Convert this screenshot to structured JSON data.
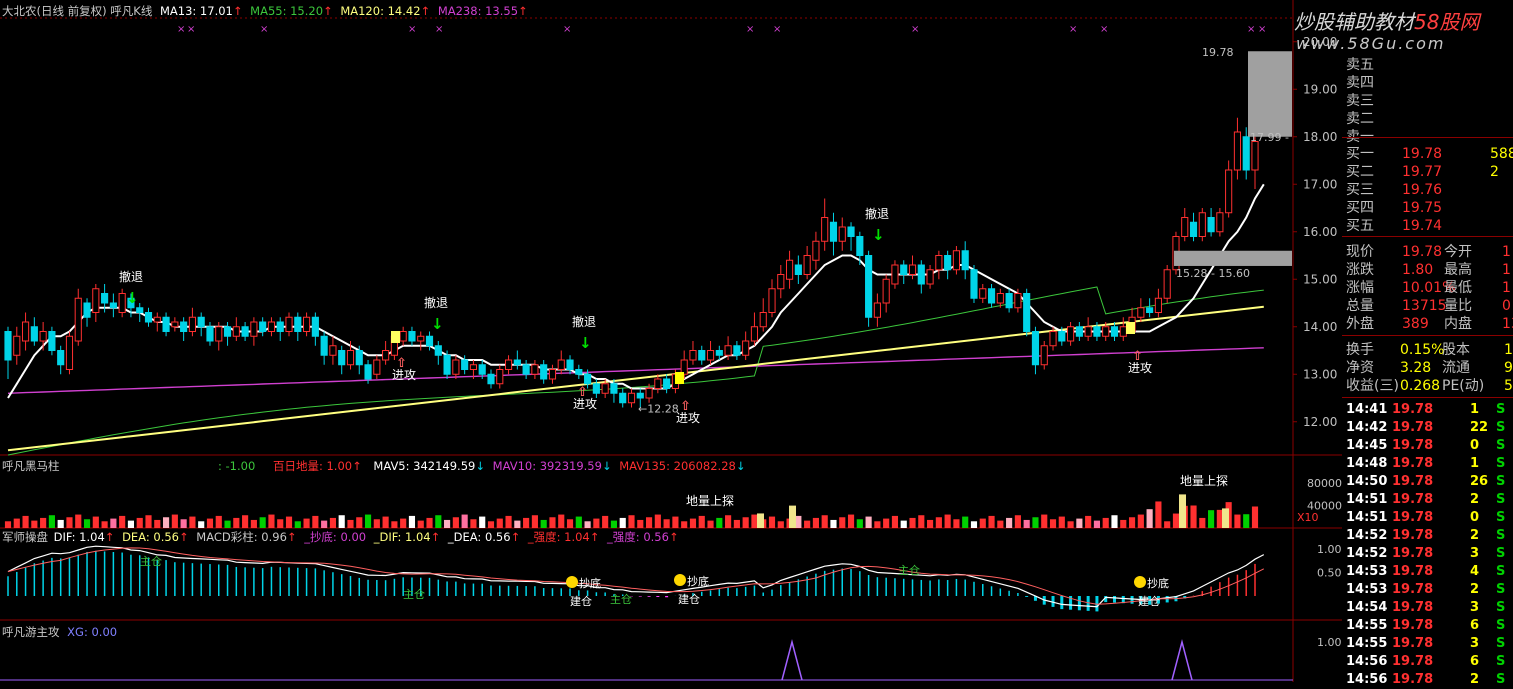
{
  "colors": {
    "bg": "#000000",
    "grid": "#8b0000",
    "up": "#ff3030",
    "down": "#00d4e8",
    "ma13": "#ffffff",
    "ma55": "#3cc63c",
    "ma120": "#ffff80",
    "ma238": "#d040d0",
    "label": "#ffffff",
    "green_arrow": "#00e000"
  },
  "main_header": {
    "title": "大北农(日线 前复权) 呼凡K线",
    "ma13": "MA13: 17.01",
    "ma55": "MA55: 15.20",
    "ma120": "MA120: 14.42",
    "ma238": "MA238: 13.55"
  },
  "vol_header": {
    "title": "呼凡黑马柱",
    "neg": ": -1.00",
    "baiday": "百日地量: 1.00",
    "mav5": "MAV5: 342149.59",
    "mav10": "MAV10: 392319.59",
    "mav135": "MAV135: 206082.28"
  },
  "macd_header": {
    "title": "军师操盘",
    "dif": "DIF: 1.04",
    "dea": "DEA: 0.56",
    "macd": "MACD彩柱: 0.96",
    "chaodi": "_抄底: 0.00",
    "dif2": "_DIF: 1.04",
    "dea2": "_DEA: 0.56",
    "qiang1": "_强度: 1.04",
    "qiang2": "_强度: 0.56"
  },
  "xg_header": {
    "title": "呼凡游主攻",
    "xg": "XG: 0.00"
  },
  "watermark": {
    "line1": "炒股辅助教材",
    "brand": "58股网",
    "url": "www.58Gu.com"
  },
  "annotations": {
    "retreat": "撤退",
    "attack": "进攻",
    "probe": "地量上探",
    "chaodi": "抄底",
    "jincang": "建仓",
    "zhucang": "主仓"
  },
  "chart_data": {
    "type": "candlestick",
    "price_axis": {
      "ylim": [
        11.3,
        20.5
      ],
      "ticks": [
        "12.00",
        "13.00",
        "14.00",
        "15.00",
        "16.00",
        "17.00",
        "18.00",
        "19.00",
        "20.00"
      ]
    },
    "volume_axis": {
      "ticks": [
        "80000",
        "40000"
      ],
      "unit": "X10"
    },
    "macd_axis": {
      "ticks": [
        "1.00",
        "0.50"
      ]
    },
    "xg_axis": {
      "ticks": [
        "1.00"
      ]
    },
    "price_labels": [
      "19.78",
      "17.99",
      "15.28 - 15.60",
      "12.28"
    ],
    "candles": [
      [
        13.9,
        13.3,
        14.0,
        12.9
      ],
      [
        13.4,
        13.8,
        14.0,
        13.2
      ],
      [
        13.7,
        14.1,
        14.3,
        13.5
      ],
      [
        14.0,
        13.7,
        14.2,
        13.6
      ],
      [
        13.7,
        13.9,
        14.1,
        13.5
      ],
      [
        13.9,
        13.5,
        14.0,
        13.4
      ],
      [
        13.5,
        13.2,
        13.6,
        13.0
      ],
      [
        13.1,
        13.8,
        13.9,
        13.0
      ],
      [
        13.7,
        14.6,
        14.8,
        13.6
      ],
      [
        14.5,
        14.2,
        14.6,
        14.0
      ],
      [
        14.3,
        14.8,
        14.9,
        14.1
      ],
      [
        14.7,
        14.5,
        14.9,
        14.3
      ],
      [
        14.5,
        14.4,
        14.7,
        14.2
      ],
      [
        14.3,
        14.7,
        14.8,
        14.2
      ],
      [
        14.6,
        14.4,
        14.7,
        14.2
      ],
      [
        14.4,
        14.3,
        14.5,
        14.1
      ],
      [
        14.3,
        14.1,
        14.4,
        14.0
      ],
      [
        14.1,
        14.2,
        14.3,
        13.9
      ],
      [
        14.2,
        13.9,
        14.3,
        13.8
      ],
      [
        14.0,
        14.1,
        14.2,
        13.9
      ],
      [
        14.1,
        13.9,
        14.2,
        13.7
      ],
      [
        13.9,
        14.2,
        14.4,
        13.8
      ],
      [
        14.2,
        14.0,
        14.3,
        13.8
      ],
      [
        14.0,
        13.7,
        14.1,
        13.6
      ],
      [
        13.7,
        14.0,
        14.1,
        13.5
      ],
      [
        14.0,
        13.8,
        14.1,
        13.6
      ],
      [
        13.8,
        14.0,
        14.2,
        13.7
      ],
      [
        14.0,
        13.8,
        14.1,
        13.7
      ],
      [
        13.8,
        14.1,
        14.2,
        13.6
      ],
      [
        14.1,
        13.9,
        14.2,
        13.8
      ],
      [
        13.9,
        14.1,
        14.2,
        13.8
      ],
      [
        14.1,
        13.9,
        14.2,
        13.7
      ],
      [
        13.9,
        14.2,
        14.3,
        13.8
      ],
      [
        14.2,
        13.9,
        14.3,
        13.7
      ],
      [
        13.9,
        14.2,
        14.3,
        13.8
      ],
      [
        14.2,
        13.8,
        14.3,
        13.6
      ],
      [
        13.8,
        13.4,
        13.9,
        13.2
      ],
      [
        13.4,
        13.6,
        13.8,
        13.2
      ],
      [
        13.5,
        13.2,
        13.6,
        13.0
      ],
      [
        13.2,
        13.5,
        13.7,
        13.1
      ],
      [
        13.5,
        13.2,
        13.6,
        13.0
      ],
      [
        13.2,
        12.9,
        13.3,
        12.8
      ],
      [
        13.0,
        13.3,
        13.4,
        12.9
      ],
      [
        13.3,
        13.5,
        13.7,
        13.2
      ],
      [
        13.4,
        13.8,
        13.9,
        13.3
      ],
      [
        13.7,
        13.9,
        14.0,
        13.6
      ],
      [
        13.9,
        13.7,
        14.0,
        13.6
      ],
      [
        13.7,
        13.8,
        13.9,
        13.5
      ],
      [
        13.8,
        13.6,
        13.9,
        13.5
      ],
      [
        13.6,
        13.4,
        13.7,
        13.2
      ],
      [
        13.4,
        13.0,
        13.5,
        12.9
      ],
      [
        13.0,
        13.3,
        13.4,
        12.9
      ],
      [
        13.3,
        13.1,
        13.4,
        13.0
      ],
      [
        13.1,
        13.2,
        13.3,
        12.9
      ],
      [
        13.2,
        13.0,
        13.3,
        12.9
      ],
      [
        13.0,
        12.8,
        13.1,
        12.7
      ],
      [
        12.8,
        13.1,
        13.2,
        12.7
      ],
      [
        13.1,
        13.3,
        13.4,
        13.0
      ],
      [
        13.3,
        13.2,
        13.5,
        13.1
      ],
      [
        13.2,
        13.0,
        13.3,
        12.9
      ],
      [
        13.0,
        13.2,
        13.3,
        12.9
      ],
      [
        13.2,
        12.9,
        13.3,
        12.8
      ],
      [
        12.9,
        13.1,
        13.2,
        12.8
      ],
      [
        13.1,
        13.3,
        13.5,
        13.0
      ],
      [
        13.3,
        13.1,
        13.4,
        13.0
      ],
      [
        13.1,
        13.0,
        13.2,
        12.9
      ],
      [
        13.0,
        12.8,
        13.1,
        12.7
      ],
      [
        12.8,
        12.6,
        12.9,
        12.5
      ],
      [
        12.6,
        12.8,
        12.9,
        12.5
      ],
      [
        12.8,
        12.6,
        12.9,
        12.4
      ],
      [
        12.6,
        12.4,
        12.7,
        12.3
      ],
      [
        12.4,
        12.6,
        12.7,
        12.3
      ],
      [
        12.6,
        12.5,
        12.7,
        12.3
      ],
      [
        12.5,
        12.7,
        12.8,
        12.4
      ],
      [
        12.7,
        12.9,
        13.0,
        12.6
      ],
      [
        12.9,
        12.7,
        13.0,
        12.6
      ],
      [
        12.7,
        13.0,
        13.1,
        12.6
      ],
      [
        13.0,
        13.3,
        13.5,
        12.9
      ],
      [
        13.3,
        13.5,
        13.7,
        13.2
      ],
      [
        13.5,
        13.3,
        13.6,
        13.2
      ],
      [
        13.3,
        13.5,
        13.7,
        13.2
      ],
      [
        13.5,
        13.4,
        13.6,
        13.3
      ],
      [
        13.4,
        13.6,
        13.8,
        13.3
      ],
      [
        13.6,
        13.4,
        13.7,
        13.3
      ],
      [
        13.4,
        13.7,
        13.9,
        13.3
      ],
      [
        13.7,
        14.0,
        14.3,
        13.6
      ],
      [
        14.0,
        14.3,
        14.6,
        13.9
      ],
      [
        14.3,
        14.8,
        15.0,
        14.2
      ],
      [
        14.8,
        15.1,
        15.3,
        14.6
      ],
      [
        15.0,
        15.4,
        15.6,
        14.8
      ],
      [
        15.3,
        15.1,
        15.5,
        14.9
      ],
      [
        15.1,
        15.5,
        15.7,
        15.0
      ],
      [
        15.4,
        15.8,
        16.0,
        15.2
      ],
      [
        15.8,
        16.3,
        16.7,
        15.6
      ],
      [
        16.2,
        15.8,
        16.4,
        15.5
      ],
      [
        15.8,
        16.1,
        16.3,
        15.6
      ],
      [
        16.1,
        15.9,
        16.2,
        15.6
      ],
      [
        15.9,
        15.5,
        16.0,
        15.3
      ],
      [
        15.5,
        14.2,
        15.6,
        14.0
      ],
      [
        14.2,
        14.5,
        14.7,
        14.0
      ],
      [
        14.5,
        15.0,
        15.1,
        14.3
      ],
      [
        14.9,
        15.3,
        15.4,
        14.8
      ],
      [
        15.3,
        15.1,
        15.4,
        14.9
      ],
      [
        15.1,
        15.3,
        15.5,
        15.0
      ],
      [
        15.3,
        14.9,
        15.4,
        14.7
      ],
      [
        14.9,
        15.2,
        15.3,
        14.8
      ],
      [
        15.2,
        15.5,
        15.6,
        15.0
      ],
      [
        15.5,
        15.2,
        15.6,
        15.0
      ],
      [
        15.2,
        15.6,
        15.7,
        15.1
      ],
      [
        15.6,
        15.2,
        15.8,
        15.0
      ],
      [
        15.2,
        14.6,
        15.3,
        14.5
      ],
      [
        14.6,
        14.8,
        14.9,
        14.5
      ],
      [
        14.8,
        14.5,
        14.9,
        14.4
      ],
      [
        14.5,
        14.7,
        14.8,
        14.4
      ],
      [
        14.7,
        14.4,
        14.8,
        14.3
      ],
      [
        14.4,
        14.7,
        14.8,
        14.3
      ],
      [
        14.7,
        13.9,
        14.8,
        13.8
      ],
      [
        13.9,
        13.2,
        14.0,
        13.0
      ],
      [
        13.2,
        13.6,
        13.7,
        13.1
      ],
      [
        13.6,
        13.9,
        14.0,
        13.5
      ],
      [
        13.9,
        13.7,
        14.0,
        13.6
      ],
      [
        13.7,
        14.0,
        14.1,
        13.6
      ],
      [
        14.0,
        13.8,
        14.1,
        13.7
      ],
      [
        13.8,
        14.0,
        14.2,
        13.7
      ],
      [
        14.0,
        13.8,
        14.1,
        13.7
      ],
      [
        13.8,
        14.0,
        14.1,
        13.7
      ],
      [
        14.0,
        13.8,
        14.1,
        13.7
      ],
      [
        13.8,
        14.0,
        14.2,
        13.7
      ],
      [
        13.9,
        14.2,
        14.4,
        13.9
      ],
      [
        14.2,
        14.4,
        14.6,
        14.1
      ],
      [
        14.4,
        14.3,
        14.6,
        14.2
      ],
      [
        14.3,
        14.6,
        14.8,
        14.2
      ],
      [
        14.6,
        15.2,
        15.3,
        14.5
      ],
      [
        15.2,
        15.9,
        16.0,
        15.1
      ],
      [
        15.9,
        16.3,
        16.5,
        15.8
      ],
      [
        16.2,
        15.9,
        16.4,
        15.8
      ],
      [
        15.9,
        16.4,
        16.5,
        15.8
      ],
      [
        16.3,
        16.0,
        16.5,
        15.9
      ],
      [
        16.0,
        16.4,
        16.5,
        15.9
      ],
      [
        16.4,
        17.3,
        17.5,
        16.3
      ],
      [
        17.3,
        18.1,
        18.4,
        17.1
      ],
      [
        18.0,
        17.3,
        18.2,
        17.1
      ],
      [
        17.3,
        17.9,
        18.0,
        16.9
      ]
    ],
    "ma13": [
      12.5,
      12.8,
      13.1,
      13.4,
      13.6,
      13.8,
      13.8,
      13.9,
      14.1,
      14.3,
      14.4,
      14.4,
      14.4,
      14.4,
      14.3,
      14.3,
      14.2,
      14.1,
      14.1,
      14.0,
      14.0,
      14.0,
      14.0,
      14.0,
      14.0,
      14.0,
      13.9,
      13.9,
      13.9,
      13.9,
      14.0,
      14.0,
      14.0,
      14.0,
      14.0,
      14.0,
      13.9,
      13.8,
      13.7,
      13.6,
      13.5,
      13.4,
      13.4,
      13.4,
      13.5,
      13.6,
      13.6,
      13.6,
      13.6,
      13.5,
      13.4,
      13.4,
      13.3,
      13.3,
      13.3,
      13.2,
      13.2,
      13.2,
      13.2,
      13.2,
      13.2,
      13.1,
      13.1,
      13.1,
      13.1,
      13.0,
      13.0,
      12.9,
      12.9,
      12.8,
      12.8,
      12.7,
      12.7,
      12.7,
      12.7,
      12.7,
      12.8,
      12.9,
      13.0,
      13.1,
      13.2,
      13.3,
      13.4,
      13.4,
      13.5,
      13.6,
      13.8,
      14.0,
      14.3,
      14.5,
      14.7,
      14.9,
      15.1,
      15.3,
      15.4,
      15.5,
      15.5,
      15.4,
      15.2,
      15.1,
      15.1,
      15.1,
      15.1,
      15.1,
      15.1,
      15.1,
      15.2,
      15.2,
      15.3,
      15.3,
      15.2,
      15.1,
      15.0,
      14.9,
      14.8,
      14.7,
      14.5,
      14.3,
      14.1,
      14.0,
      13.9,
      13.9,
      13.9,
      13.9,
      13.9,
      13.9,
      13.9,
      13.9,
      13.9,
      13.9,
      13.9,
      14.0,
      14.1,
      14.2,
      14.4,
      14.6,
      14.9,
      15.2,
      15.5,
      15.8,
      16.0,
      16.3,
      16.7,
      17.0
    ]
  },
  "side_panel": {
    "asks": [
      {
        "label": "卖五",
        "price": "",
        "vol": ""
      },
      {
        "label": "卖四",
        "price": "",
        "vol": ""
      },
      {
        "label": "卖三",
        "price": "",
        "vol": ""
      },
      {
        "label": "卖二",
        "price": "",
        "vol": ""
      },
      {
        "label": "卖一",
        "price": "",
        "vol": ""
      }
    ],
    "bids": [
      {
        "label": "买一",
        "price": "19.78",
        "vol": "588"
      },
      {
        "label": "买二",
        "price": "19.77",
        "vol": "2"
      },
      {
        "label": "买三",
        "price": "19.76",
        "vol": ""
      },
      {
        "label": "买四",
        "price": "19.75",
        "vol": ""
      },
      {
        "label": "买五",
        "price": "19.74",
        "vol": ""
      }
    ],
    "quotes": [
      {
        "l1": "现价",
        "v1": "19.78",
        "l2": "今开",
        "v2": "1"
      },
      {
        "l1": "涨跌",
        "v1": "1.80",
        "l2": "最高",
        "v2": "1"
      },
      {
        "l1": "涨幅",
        "v1": "10.01%",
        "l2": "最低",
        "v2": "1"
      },
      {
        "l1": "总量",
        "v1": "13715",
        "l2": "量比",
        "v2": "0"
      },
      {
        "l1": "外盘",
        "v1": "389",
        "l2": "内盘",
        "v2": "13"
      }
    ],
    "stats": [
      {
        "l1": "换手",
        "v1": "0.15%",
        "l2": "股本",
        "v2": "16."
      },
      {
        "l1": "净资",
        "v1": "3.28",
        "l2": "流通",
        "v2": "9.4"
      },
      {
        "l1": "收益(三)",
        "v1": "0.268",
        "l2": "PE(动)",
        "v2": "5"
      }
    ],
    "ticks": [
      {
        "t": "14:41",
        "p": "19.78",
        "v": "1",
        "s": "S"
      },
      {
        "t": "14:42",
        "p": "19.78",
        "v": "22",
        "s": "S"
      },
      {
        "t": "14:45",
        "p": "19.78",
        "v": "0",
        "s": "S"
      },
      {
        "t": "14:48",
        "p": "19.78",
        "v": "1",
        "s": "S"
      },
      {
        "t": "14:50",
        "p": "19.78",
        "v": "26",
        "s": "S"
      },
      {
        "t": "14:51",
        "p": "19.78",
        "v": "2",
        "s": "S"
      },
      {
        "t": "14:51",
        "p": "19.78",
        "v": "0",
        "s": "S"
      },
      {
        "t": "14:52",
        "p": "19.78",
        "v": "2",
        "s": "S"
      },
      {
        "t": "14:52",
        "p": "19.78",
        "v": "3",
        "s": "S"
      },
      {
        "t": "14:53",
        "p": "19.78",
        "v": "4",
        "s": "S"
      },
      {
        "t": "14:53",
        "p": "19.78",
        "v": "2",
        "s": "S"
      },
      {
        "t": "14:54",
        "p": "19.78",
        "v": "3",
        "s": "S"
      },
      {
        "t": "14:55",
        "p": "19.78",
        "v": "6",
        "s": "S"
      },
      {
        "t": "14:55",
        "p": "19.78",
        "v": "3",
        "s": "S"
      },
      {
        "t": "14:56",
        "p": "19.78",
        "v": "6",
        "s": "S"
      },
      {
        "t": "14:56",
        "p": "19.78",
        "v": "2",
        "s": "S"
      }
    ]
  }
}
